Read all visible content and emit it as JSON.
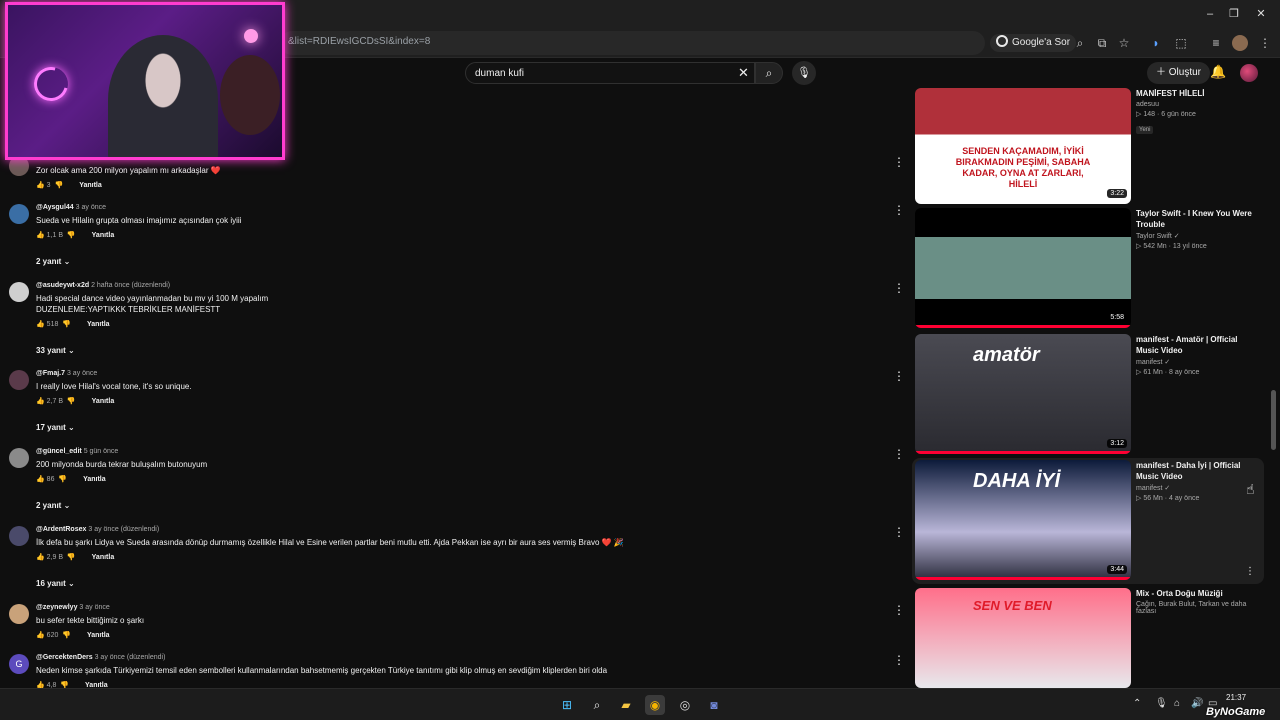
{
  "browser": {
    "url": "&list=RDIEwsIGCDsSI&index=8",
    "ask_google": "Google'a Sor"
  },
  "youtube": {
    "search_query": "duman kufi",
    "create_label": "Oluştur"
  },
  "comments": [
    {
      "author": "",
      "time": "",
      "text": "Zor olcak ama 200 milyon yapalım mı arkadaşlar ❤️",
      "likes": "3",
      "reply_label": "Yanıtla",
      "avatar_color": "#6b5a56"
    },
    {
      "author": "@Aysgul44",
      "time": "3 ay önce",
      "text": "Sueda ve Hilalin grupta olması imajımız açısından çok iyiii",
      "likes": "1,1 B",
      "reply_label": "Yanıtla",
      "replies": "2 yanıt",
      "avatar_color": "#3a6ea5"
    },
    {
      "author": "@asudeywt-x2d",
      "time": "2 hafta önce (düzenlendi)",
      "text": "Hadi special dance video yayınlanmadan bu mv yi 100 M yapalım",
      "text2": "DUZENLEME:YAPTIKKK TEBRİKLER MANİFESTT",
      "likes": "518",
      "reply_label": "Yanıtla",
      "replies": "33 yanıt",
      "avatar_color": "#cfcfcf"
    },
    {
      "author": "@Fmaj.7",
      "time": "3 ay önce",
      "text": "I really love Hilal's vocal tone, it's so unique.",
      "likes": "2,7 B",
      "reply_label": "Yanıtla",
      "replies": "17 yanıt",
      "avatar_color": "#5a3a4a"
    },
    {
      "author": "@güncel_edit",
      "time": "5 gün önce",
      "text": "200 milyonda burda tekrar buluşalım butonuyum",
      "likes": "86",
      "reply_label": "Yanıtla",
      "replies": "2 yanıt",
      "avatar_color": "#8a8a8a"
    },
    {
      "author": "@ArdentRosex",
      "time": "3 ay önce (düzenlendi)",
      "text": "İlk defa bu şarkı Lidya ve Sueda arasında dönüp durmamış özellikle Hilal ve Esine verilen partlar beni mutlu etti. Ajda Pekkan ise ayrı bir aura ses vermiş Bravo ❤️ 🎉",
      "likes": "2,9 B",
      "reply_label": "Yanıtla",
      "replies": "16 yanıt",
      "avatar_color": "#4a4a6a"
    },
    {
      "author": "@zeynewlyy",
      "time": "3 ay önce",
      "text": "bu sefer tekte bittiğimiz o şarkı",
      "likes": "620",
      "reply_label": "Yanıtla",
      "avatar_color": "#c9a27a"
    },
    {
      "author": "@GercektenDers",
      "time": "3 ay önce (düzenlendi)",
      "text": "Neden kimse şarkıda Türkiyemizi temsil eden sembolleri kullanmalarından bahsetmemiş gerçekten Türkiye tanıtımı gibi klip olmuş en sevdiğim kliplerden biri olda",
      "likes": "4,8",
      "reply_label": "Yanıtla",
      "avatar_letter": "G",
      "avatar_color": "#5c4bbd"
    }
  ],
  "sidebar": [
    {
      "title": "MANİFEST HİLELİ",
      "channel": "adesuu",
      "meta": "▷ 148 · 6 gün önce",
      "badge": "Yeni",
      "duration": "3:22",
      "thumb_text": "SENDEN KAÇAMADIM, İYİKİ BIRAKMADIN PEŞİMİ, SABAHA KADAR, OYNA AT ZARLARI, HİLELİ"
    },
    {
      "title": "Taylor Swift - I Knew You Were Trouble",
      "channel": "Taylor Swift ✓",
      "meta": "▷ 542 Mn · 13 yıl önce",
      "duration": "5:58",
      "progress": 1.0
    },
    {
      "title": "manifest - Amatör | Official Music Video",
      "channel": "manifest ✓",
      "meta": "▷ 61 Mn · 8 ay önce",
      "duration": "3:12",
      "thumb_text": "amatör",
      "progress": 1.0
    },
    {
      "title": "manifest - Daha İyi | Official Music Video",
      "channel": "manifest ✓",
      "meta": "▷ 56 Mn · 4 ay önce",
      "duration": "3:44",
      "thumb_text": "DAHA İYİ",
      "progress": 1.0
    },
    {
      "title": "Mix - Orta Doğu Müziği",
      "channel": "Çağın, Burak Bulut, Tarkan ve daha fazlası",
      "meta": "",
      "thumb_text": "SEN VE BEN"
    }
  ],
  "taskbar": {
    "time": "21:37",
    "watermark": "ByNoGame"
  }
}
